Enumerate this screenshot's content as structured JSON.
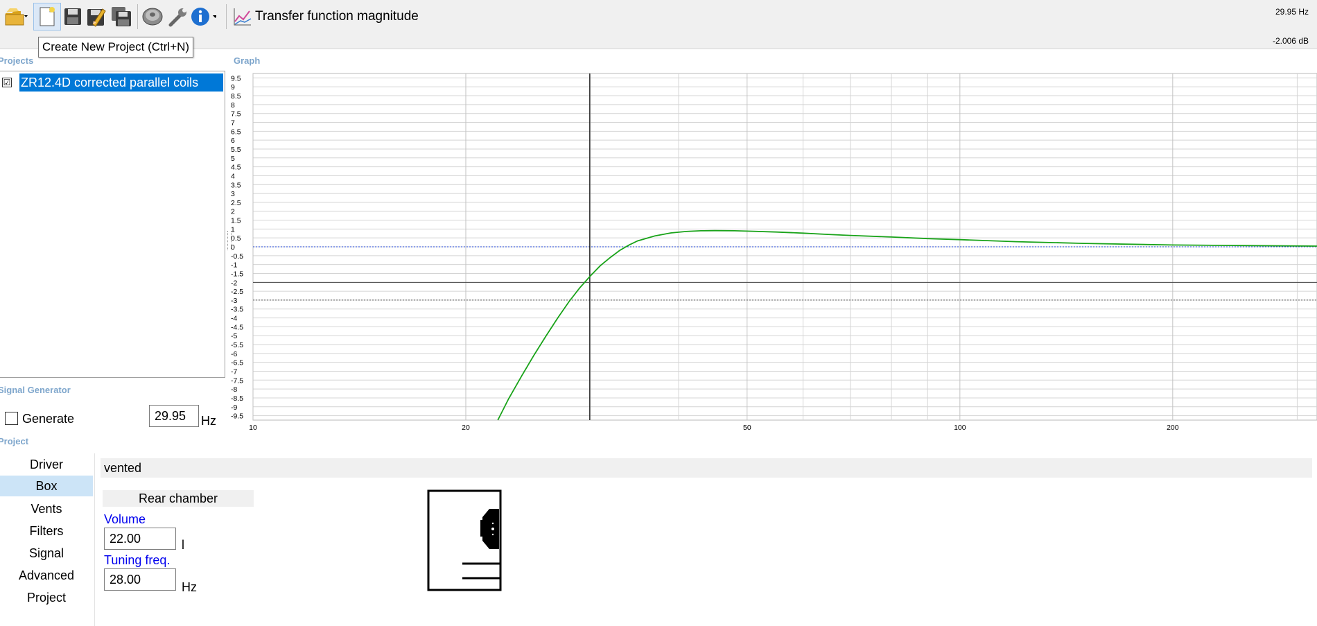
{
  "toolbar": {
    "buttons": [
      "open-folder-icon",
      "new-project-icon",
      "save-icon",
      "save-as-icon",
      "save-all-icon",
      "driver-icon",
      "settings-wrench-icon",
      "info-icon"
    ],
    "view_title": "Transfer function magnitude",
    "readout_hz": "29.95 Hz",
    "readout_db": "-2.006 dB",
    "tooltip": "Create New Project (Ctrl+N)"
  },
  "projects": {
    "section_label": "Projects",
    "items": [
      {
        "label": "ZR12.4D corrected parallel coils",
        "checked": true,
        "checkmark": "☑"
      }
    ]
  },
  "graph": {
    "section_label": "Graph"
  },
  "signal_generator": {
    "section_label": "Signal Generator",
    "generate_label": "Generate",
    "generate_checked": false,
    "frequency_value": "29.95",
    "frequency_unit": "Hz"
  },
  "project_section": {
    "section_label": "Project",
    "nav": [
      "Driver",
      "Box",
      "Vents",
      "Filters",
      "Signal",
      "Advanced",
      "Project"
    ],
    "active_nav": "Box"
  },
  "box": {
    "type": "vented",
    "chamber_title": "Rear chamber",
    "volume_label": "Volume",
    "volume_value": "22.00",
    "volume_unit": "l",
    "tuning_label": "Tuning freq.",
    "tuning_value": "28.00",
    "tuning_unit": "Hz"
  },
  "chart_data": {
    "type": "line",
    "title": "",
    "xlabel": "",
    "ylabel": "",
    "x_scale": "log",
    "xlim": [
      10,
      320
    ],
    "ylim": [
      -9.75,
      9.75
    ],
    "x_ticks": [
      10,
      20,
      50,
      100,
      200
    ],
    "x_tick_labels": [
      "10",
      "20",
      "50",
      "100",
      "200"
    ],
    "y_ticks": [
      9.5,
      9,
      8.5,
      8,
      7.5,
      7,
      6.5,
      6,
      5.5,
      5,
      4.5,
      4,
      3.5,
      3,
      2.5,
      2,
      1.5,
      1,
      0.5,
      0,
      -0.5,
      -1,
      -1.5,
      -2,
      -2.5,
      -3,
      -3.5,
      -4,
      -4.5,
      -5,
      -5.5,
      -6,
      -6.5,
      -7,
      -7.5,
      -8,
      -8.5,
      -9,
      -9.5
    ],
    "y_tick_labels": [
      "9.5",
      "9",
      "8.5",
      "8",
      "7.5",
      "7",
      "6.5",
      "6",
      "5.5",
      "5",
      "4.5",
      "4",
      "3.5",
      "3",
      "2.5",
      "2",
      "1.5",
      "1",
      "0.5",
      "0",
      "-0.5",
      "-1",
      "-1.5",
      "-2",
      "-2.5",
      "-3",
      "-3.5",
      "-4",
      "-4.5",
      "-5",
      "-5.5",
      "-6",
      "-6.5",
      "-7",
      "-7.5",
      "-8",
      "-8.5",
      "-9",
      "-9.5"
    ],
    "grid": true,
    "reference_lines": [
      {
        "y": 0,
        "style": "dotted",
        "color": "#1a3fd8"
      },
      {
        "y": -3,
        "style": "dotted",
        "color": "#555555"
      }
    ],
    "cursor": {
      "x": 29.95,
      "y": -2.006,
      "color": "#000000"
    },
    "series": [
      {
        "color": "#19a319",
        "x": [
          22.2,
          23,
          24,
          25,
          26,
          27,
          28,
          29,
          30,
          31,
          32,
          33,
          34,
          35,
          37,
          39,
          41,
          43,
          45,
          48,
          50,
          55,
          60,
          65,
          70,
          80,
          90,
          100,
          120,
          150,
          200,
          250,
          320
        ],
        "y": [
          -9.75,
          -8.54,
          -7.25,
          -6.07,
          -4.99,
          -3.99,
          -3.08,
          -2.3,
          -1.64,
          -1.06,
          -0.61,
          -0.21,
          0.09,
          0.33,
          0.61,
          0.78,
          0.86,
          0.9,
          0.91,
          0.9,
          0.88,
          0.83,
          0.77,
          0.7,
          0.64,
          0.55,
          0.46,
          0.4,
          0.29,
          0.19,
          0.1,
          0.07,
          0.04
        ]
      }
    ]
  }
}
